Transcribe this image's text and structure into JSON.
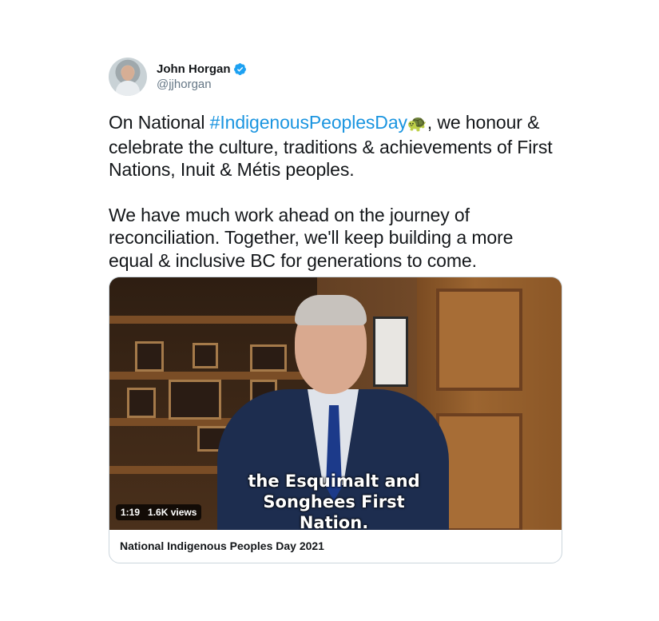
{
  "author": {
    "name": "John Horgan",
    "handle": "@jjhorgan"
  },
  "tweet": {
    "line1_prefix": "On National ",
    "hashtag": "#IndigenousPeoplesDay",
    "emoji": "🐢",
    "line1_suffix": ", we honour & celebrate the culture, traditions & achievements of First Nations, Inuit & Métis peoples.",
    "paragraph2": "We have much work ahead on the journey of reconciliation. Together, we'll keep building a more equal & inclusive BC for generations to come."
  },
  "video": {
    "subtitle_line1": "the Esquimalt and",
    "subtitle_line2": "Songhees First Nation.",
    "duration": "1:19",
    "views": "1.6K views",
    "card_title": "National Indigenous Peoples Day 2021"
  },
  "colors": {
    "hashtag": "#1b95e0",
    "verified": "#1da1f2"
  },
  "icons": {
    "verified": "verified-badge-icon"
  }
}
